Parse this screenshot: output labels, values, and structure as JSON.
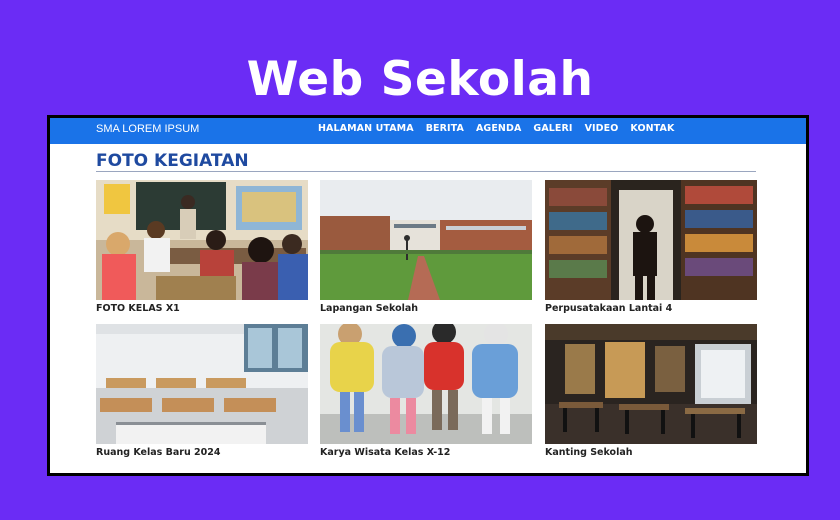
{
  "hero": {
    "title": "Web Sekolah"
  },
  "navbar": {
    "brand": "SMA LOREM IPSUM",
    "links": [
      "HALAMAN UTAMA",
      "BERITA",
      "AGENDA",
      "GALERI",
      "VIDEO",
      "KONTAK"
    ]
  },
  "gallery": {
    "title": "FOTO KEGIATAN",
    "items": [
      {
        "caption": "FOTO KELAS X1",
        "icon": "classroom-photo"
      },
      {
        "caption": "Lapangan Sekolah",
        "icon": "campus-field-photo"
      },
      {
        "caption": "Perpusatakaan Lantai 4",
        "icon": "library-photo"
      },
      {
        "caption": "Ruang Kelas Baru 2024",
        "icon": "empty-classroom-photo"
      },
      {
        "caption": "Karya Wisata Kelas X-12",
        "icon": "students-backpacks-photo"
      },
      {
        "caption": "Kanting Sekolah",
        "icon": "cafeteria-photo"
      }
    ]
  },
  "colors": {
    "background": "#6b2cf5",
    "navbar": "#1a73e8",
    "section_title": "#1f4aa0"
  }
}
